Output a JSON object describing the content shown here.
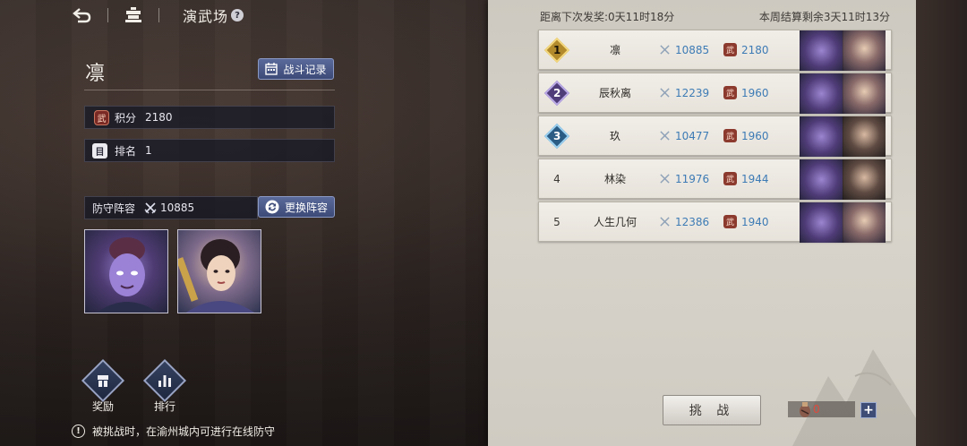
{
  "header": {
    "title": "演武场",
    "help": "?"
  },
  "player": {
    "name": "凛"
  },
  "buttons": {
    "battle_record": "战斗记录",
    "swap_lineup": "更换阵容",
    "challenge": "挑 战"
  },
  "stats": {
    "score_label": "积分",
    "score_value": "2180",
    "rank_label": "排名",
    "rank_value": "1",
    "wu_char": "武",
    "rank_char": "目"
  },
  "defense": {
    "label": "防守阵容",
    "power": "10885"
  },
  "bottom": {
    "reward": "奖励",
    "ranking": "排行"
  },
  "notice": "被挑战时，在渝州城内可进行在线防守",
  "timers": {
    "next_reward": "距离下次发奖:0天11时18分",
    "week_end": "本周结算剩余3天11时13分"
  },
  "ranking": [
    {
      "rank": "1",
      "name": "凛",
      "power": "10885",
      "score": "2180"
    },
    {
      "rank": "2",
      "name": "辰秋离",
      "power": "12239",
      "score": "1960"
    },
    {
      "rank": "3",
      "name": "玖",
      "power": "10477",
      "score": "1960"
    },
    {
      "rank": "4",
      "name": "林染",
      "power": "11976",
      "score": "1944"
    },
    {
      "rank": "5",
      "name": "人生几何",
      "power": "12386",
      "score": "1940"
    }
  ],
  "tickets": {
    "count": "0",
    "plus": "+"
  },
  "colors": {
    "accent_blue": "#3d7bb5",
    "gold": "#b28a2c",
    "purple": "#4f3d7a",
    "teal": "#2a5c84",
    "red_count": "#e04a3c"
  }
}
